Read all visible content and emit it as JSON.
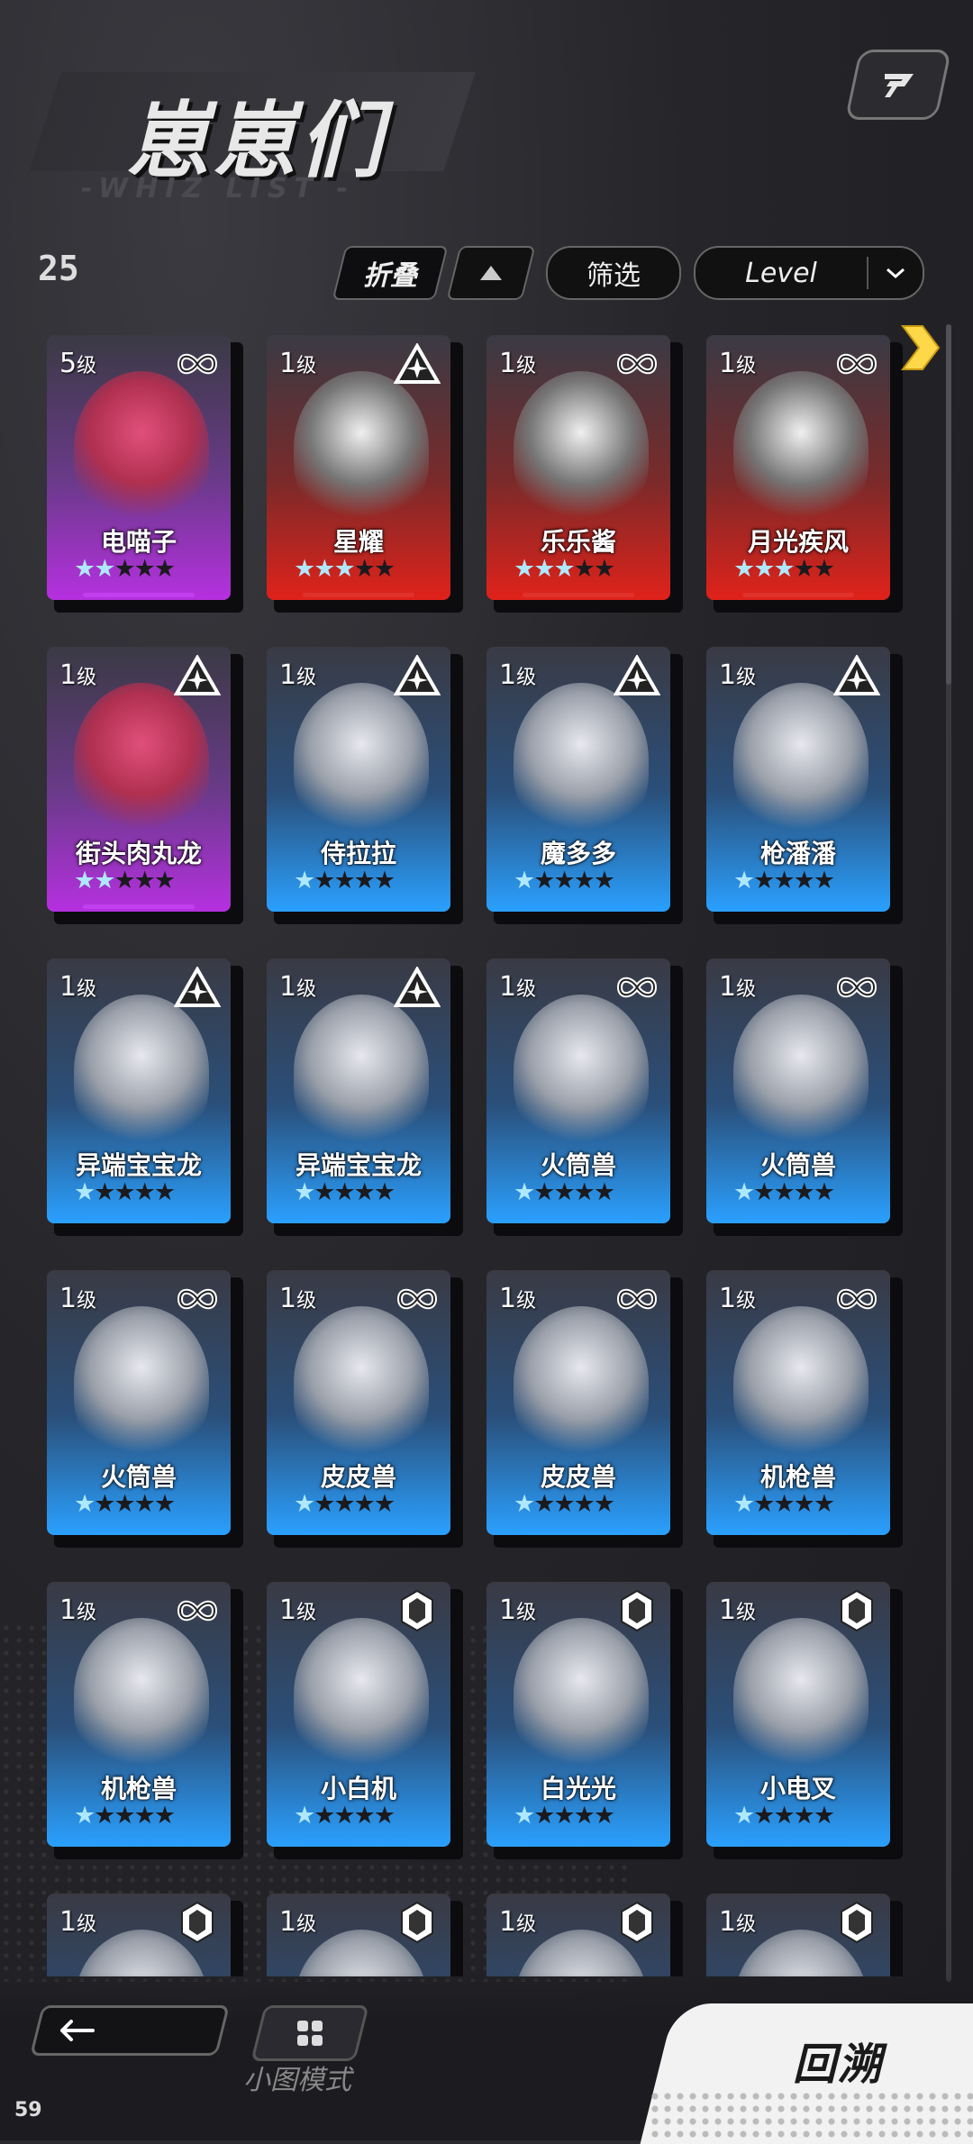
{
  "header": {
    "title": "崽崽们",
    "subtitle": "-WHIZ LIST -",
    "count": "25"
  },
  "toolbar": {
    "fold_label": "折叠",
    "filter_label": "筛选",
    "sort_label": "Level"
  },
  "level_suffix": "级",
  "cards": [
    {
      "level": "5",
      "name": "电喵子",
      "color": "purple",
      "stars": 2,
      "badge": "infinity-icon"
    },
    {
      "level": "1",
      "name": "星耀",
      "color": "red",
      "stars": 3,
      "badge": "tri-star-icon"
    },
    {
      "level": "1",
      "name": "乐乐酱",
      "color": "red",
      "stars": 3,
      "badge": "infinity-icon"
    },
    {
      "level": "1",
      "name": "月光疾风",
      "color": "red",
      "stars": 3,
      "badge": "infinity-icon"
    },
    {
      "level": "1",
      "name": "街头肉丸龙",
      "color": "purple",
      "stars": 2,
      "badge": "tri-star-icon"
    },
    {
      "level": "1",
      "name": "侍拉拉",
      "color": "blue",
      "stars": 1,
      "badge": "tri-star-icon"
    },
    {
      "level": "1",
      "name": "魔多多",
      "color": "blue",
      "stars": 1,
      "badge": "tri-star-icon"
    },
    {
      "level": "1",
      "name": "枪潘潘",
      "color": "blue",
      "stars": 1,
      "badge": "tri-star-icon"
    },
    {
      "level": "1",
      "name": "异端宝宝龙",
      "color": "blue",
      "stars": 1,
      "badge": "tri-star-icon"
    },
    {
      "level": "1",
      "name": "异端宝宝龙",
      "color": "blue",
      "stars": 1,
      "badge": "tri-star-icon"
    },
    {
      "level": "1",
      "name": "火筒兽",
      "color": "blue",
      "stars": 1,
      "badge": "infinity-icon"
    },
    {
      "level": "1",
      "name": "火筒兽",
      "color": "blue",
      "stars": 1,
      "badge": "infinity-icon"
    },
    {
      "level": "1",
      "name": "火筒兽",
      "color": "blue",
      "stars": 1,
      "badge": "infinity-icon"
    },
    {
      "level": "1",
      "name": "皮皮兽",
      "color": "blue",
      "stars": 1,
      "badge": "infinity-icon"
    },
    {
      "level": "1",
      "name": "皮皮兽",
      "color": "blue",
      "stars": 1,
      "badge": "infinity-icon"
    },
    {
      "level": "1",
      "name": "机枪兽",
      "color": "blue",
      "stars": 1,
      "badge": "infinity-icon"
    },
    {
      "level": "1",
      "name": "机枪兽",
      "color": "blue",
      "stars": 1,
      "badge": "infinity-icon"
    },
    {
      "level": "1",
      "name": "小白机",
      "color": "blue",
      "stars": 1,
      "badge": "hex-icon"
    },
    {
      "level": "1",
      "name": "白光光",
      "color": "blue",
      "stars": 1,
      "badge": "hex-icon"
    },
    {
      "level": "1",
      "name": "小电叉",
      "color": "blue",
      "stars": 1,
      "badge": "hex-icon"
    },
    {
      "level": "1",
      "name": "",
      "color": "blue",
      "stars": 0,
      "badge": "hex-icon"
    },
    {
      "level": "1",
      "name": "",
      "color": "blue",
      "stars": 0,
      "badge": "hex-icon"
    },
    {
      "level": "1",
      "name": "",
      "color": "blue",
      "stars": 0,
      "badge": "hex-icon"
    },
    {
      "level": "1",
      "name": "",
      "color": "blue",
      "stars": 0,
      "badge": "hex-icon"
    }
  ],
  "footer": {
    "mini_mode_label": "小图模式",
    "recall_label": "回溯",
    "fps": "59"
  }
}
